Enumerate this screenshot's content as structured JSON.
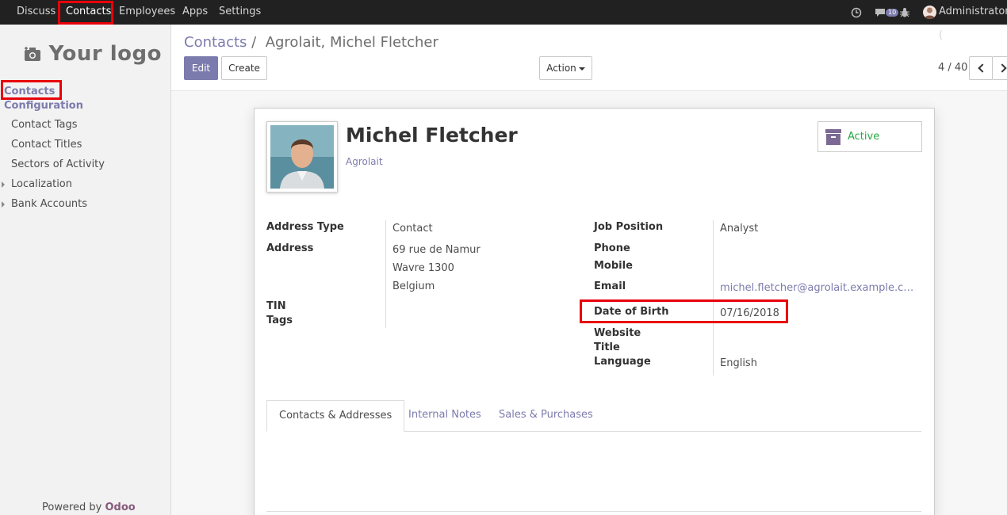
{
  "topbar": {
    "menu": [
      "Discuss",
      "Contacts",
      "Employees",
      "Apps",
      "Settings"
    ],
    "active": "Contacts",
    "message_count": "10",
    "user": "Administrator ("
  },
  "sidebar": {
    "logo_text": "Your logo",
    "section_contacts": "Contacts",
    "section_configuration": "Configuration",
    "items": [
      {
        "label": "Contact Tags"
      },
      {
        "label": "Contact Titles"
      },
      {
        "label": "Sectors of Activity"
      },
      {
        "label": "Localization"
      },
      {
        "label": "Bank Accounts"
      }
    ],
    "powered_prefix": "Powered by ",
    "powered_brand": "Odoo"
  },
  "control": {
    "breadcrumb_root": "Contacts",
    "breadcrumb_sep": "/",
    "breadcrumb_current": "Agrolait, Michel Fletcher",
    "edit_label": "Edit",
    "create_label": "Create",
    "action_label": "Action",
    "pager": "4 / 40"
  },
  "record": {
    "name": "Michel Fletcher",
    "company": "Agrolait",
    "status": "Active",
    "left_fields": {
      "address_type_label": "Address Type",
      "address_type_value": "Contact",
      "address_label": "Address",
      "address_lines": [
        "69 rue de Namur",
        "Wavre 1300",
        "Belgium"
      ],
      "tin_label": "TIN",
      "tags_label": "Tags"
    },
    "right_fields": {
      "job_label": "Job Position",
      "job_value": "Analyst",
      "phone_label": "Phone",
      "mobile_label": "Mobile",
      "email_label": "Email",
      "email_value": "michel.fletcher@agrolait.example.c…",
      "dob_label": "Date of Birth",
      "dob_value": "07/16/2018",
      "website_label": "Website",
      "title_label": "Title",
      "language_label": "Language",
      "language_value": "English"
    },
    "tabs": [
      "Contacts & Addresses",
      "Internal Notes",
      "Sales & Purchases"
    ]
  },
  "colors": {
    "accent": "#7c7bad",
    "highlight": "#e8000a",
    "topbar": "#222121",
    "status_active": "#28a745"
  }
}
